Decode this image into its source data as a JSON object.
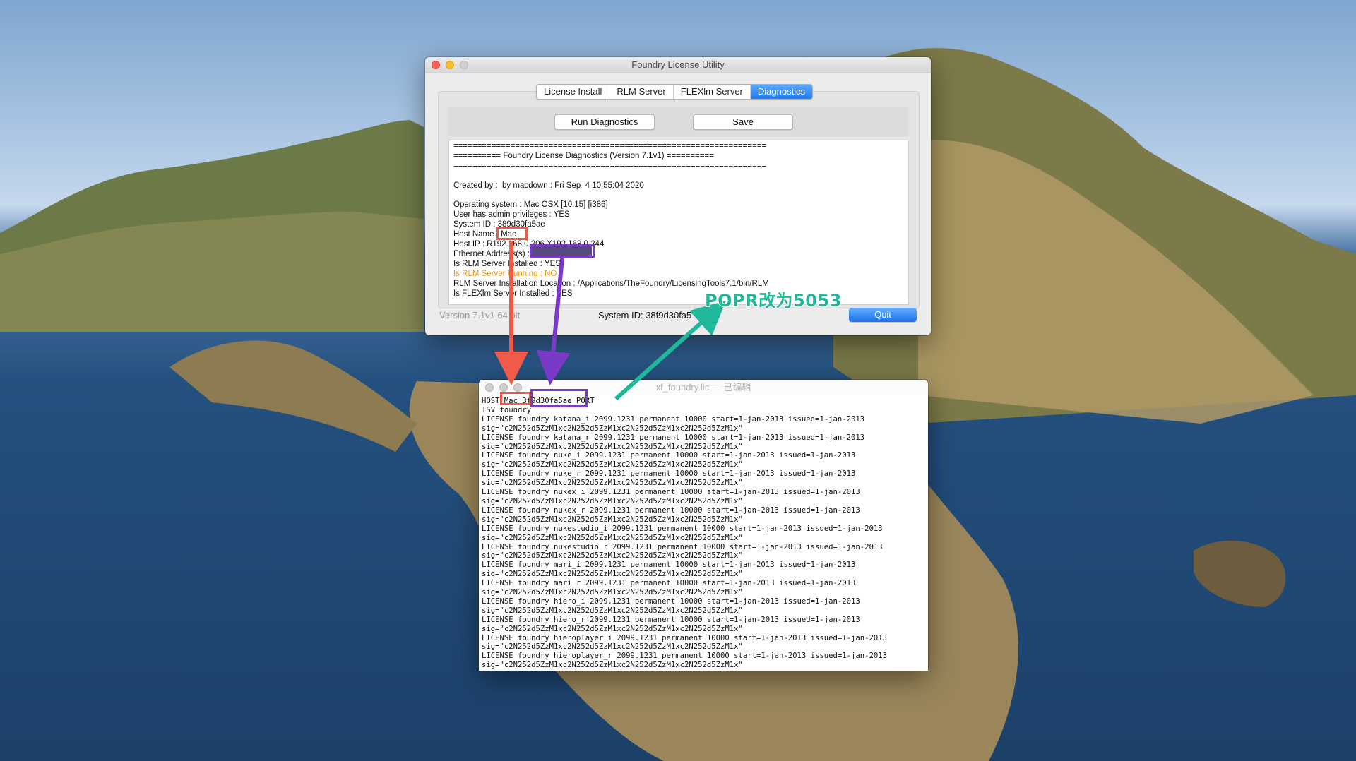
{
  "foundry_window": {
    "title": "Foundry License Utility",
    "tabs": [
      "License Install",
      "RLM Server",
      "FLEXlm Server",
      "Diagnostics"
    ],
    "active_tab": "Diagnostics",
    "buttons": {
      "run_diagnostics": "Run Diagnostics",
      "save": "Save",
      "quit": "Quit"
    },
    "diagnostics_lines": [
      "==================================================================",
      "========== Foundry License Diagnostics (Version 7.1v1) ==========",
      "==================================================================",
      "",
      "Created by :  by macdown : Fri Sep  4 10:55:04 2020",
      "",
      "Operating system : Mac OSX [10.15] [i386]",
      "User has admin privileges : YES",
      "System ID : 389d30fa5ae",
      "Host Name : Mac",
      "Host IP : R192.168.0.206 X192.168.0.244",
      "Ethernet Address(s) :",
      "Is RLM Server Installed : YES",
      "Is RLM Server Running : NO",
      "RLM Server Installation Location : /Applications/TheFoundry/LicensingTools7.1/bin/RLM",
      "Is FLEXlm Server Installed : YES"
    ],
    "footer": {
      "version": "Version 7.1v1 64 bit",
      "system_id_label": "System ID:",
      "system_id_value": "38f9d30fa5"
    }
  },
  "editor_window": {
    "title": "xf_foundry.lic — 已编辑",
    "lines": [
      "HOST Mac 3f9d30fa5ae PORT",
      "ISV foundry",
      "LICENSE foundry katana_i 2099.1231 permanent 10000 start=1-jan-2013 issued=1-jan-2013",
      "sig=\"c2N252d5ZzM1xc2N252d5ZzM1xc2N252d5ZzM1xc2N252d5ZzM1x\"",
      "LICENSE foundry katana_r 2099.1231 permanent 10000 start=1-jan-2013 issued=1-jan-2013",
      "sig=\"c2N252d5ZzM1xc2N252d5ZzM1xc2N252d5ZzM1xc2N252d5ZzM1x\"",
      "LICENSE foundry nuke_i 2099.1231 permanent 10000 start=1-jan-2013 issued=1-jan-2013",
      "sig=\"c2N252d5ZzM1xc2N252d5ZzM1xc2N252d5ZzM1xc2N252d5ZzM1x\"",
      "LICENSE foundry nuke_r 2099.1231 permanent 10000 start=1-jan-2013 issued=1-jan-2013",
      "sig=\"c2N252d5ZzM1xc2N252d5ZzM1xc2N252d5ZzM1xc2N252d5ZzM1x\"",
      "LICENSE foundry nukex_i 2099.1231 permanent 10000 start=1-jan-2013 issued=1-jan-2013",
      "sig=\"c2N252d5ZzM1xc2N252d5ZzM1xc2N252d5ZzM1xc2N252d5ZzM1x\"",
      "LICENSE foundry nukex_r 2099.1231 permanent 10000 start=1-jan-2013 issued=1-jan-2013",
      "sig=\"c2N252d5ZzM1xc2N252d5ZzM1xc2N252d5ZzM1xc2N252d5ZzM1x\"",
      "LICENSE foundry nukestudio_i 2099.1231 permanent 10000 start=1-jan-2013 issued=1-jan-2013",
      "sig=\"c2N252d5ZzM1xc2N252d5ZzM1xc2N252d5ZzM1xc2N252d5ZzM1x\"",
      "LICENSE foundry nukestudio_r 2099.1231 permanent 10000 start=1-jan-2013 issued=1-jan-2013",
      "sig=\"c2N252d5ZzM1xc2N252d5ZzM1xc2N252d5ZzM1xc2N252d5ZzM1x\"",
      "LICENSE foundry mari_i 2099.1231 permanent 10000 start=1-jan-2013 issued=1-jan-2013",
      "sig=\"c2N252d5ZzM1xc2N252d5ZzM1xc2N252d5ZzM1xc2N252d5ZzM1x\"",
      "LICENSE foundry mari_r 2099.1231 permanent 10000 start=1-jan-2013 issued=1-jan-2013",
      "sig=\"c2N252d5ZzM1xc2N252d5ZzM1xc2N252d5ZzM1xc2N252d5ZzM1x\"",
      "LICENSE foundry hiero_i 2099.1231 permanent 10000 start=1-jan-2013 issued=1-jan-2013",
      "sig=\"c2N252d5ZzM1xc2N252d5ZzM1xc2N252d5ZzM1xc2N252d5ZzM1x\"",
      "LICENSE foundry hiero_r 2099.1231 permanent 10000 start=1-jan-2013 issued=1-jan-2013",
      "sig=\"c2N252d5ZzM1xc2N252d5ZzM1xc2N252d5ZzM1xc2N252d5ZzM1x\"",
      "LICENSE foundry hieroplayer_i 2099.1231 permanent 10000 start=1-jan-2013 issued=1-jan-2013",
      "sig=\"c2N252d5ZzM1xc2N252d5ZzM1xc2N252d5ZzM1xc2N252d5ZzM1x\"",
      "LICENSE foundry hieroplayer_r 2099.1231 permanent 10000 start=1-jan-2013 issued=1-jan-2013",
      "sig=\"c2N252d5ZzM1xc2N252d5ZzM1xc2N252d5ZzM1xc2N252d5ZzM1x\""
    ]
  },
  "annotation": {
    "label": "POPR改为5053"
  },
  "colors": {
    "annotation_red": "#ef5a49",
    "annotation_purple": "#7a3ac8",
    "annotation_teal": "#1fb89a",
    "accent_blue": "#1f7ff5"
  }
}
